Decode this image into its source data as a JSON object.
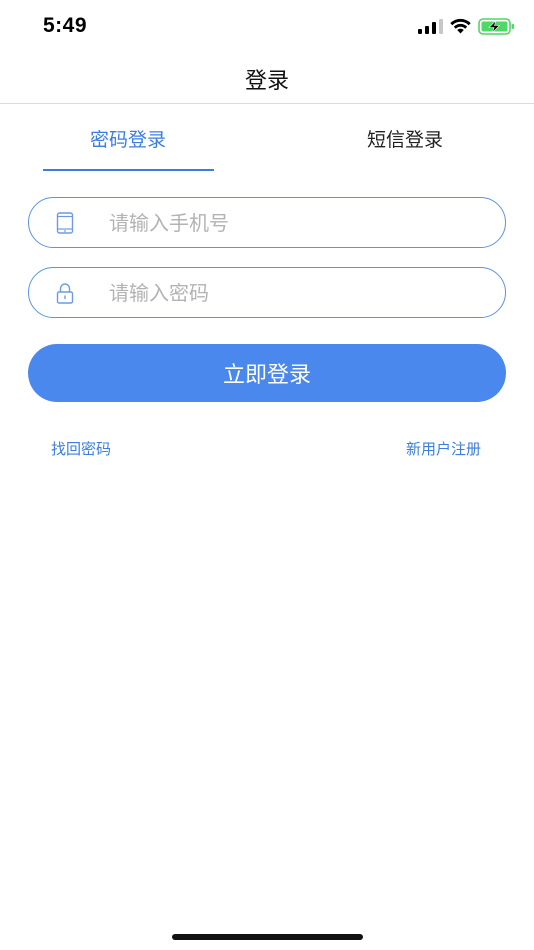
{
  "status_bar": {
    "time": "5:49",
    "icons": [
      "signal-icon",
      "wifi-icon",
      "battery-charging-icon"
    ]
  },
  "nav": {
    "title": "登录"
  },
  "tabs": [
    {
      "label": "密码登录",
      "active": true
    },
    {
      "label": "短信登录",
      "active": false
    }
  ],
  "form": {
    "phone": {
      "placeholder": "请输入手机号",
      "value": "",
      "icon": "tablet-icon"
    },
    "password": {
      "placeholder": "请输入密码",
      "value": "",
      "icon": "lock-icon"
    },
    "submit_label": "立即登录"
  },
  "links": {
    "forgot": "找回密码",
    "register": "新用户注册"
  },
  "colors": {
    "accent": "#3b7de0",
    "button": "#4a88ee",
    "field_border": "#5b93e6",
    "battery": "#4cd964"
  }
}
